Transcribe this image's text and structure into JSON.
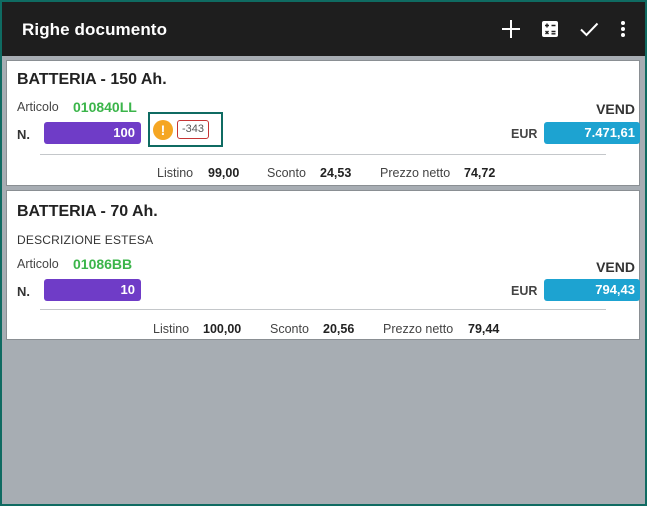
{
  "appbar": {
    "title": "Righe documento",
    "icons": [
      "add-icon",
      "calculator-icon",
      "check-icon",
      "more-vert-icon"
    ]
  },
  "labels": {
    "article": "Articolo",
    "qty": "N.",
    "currency": "EUR",
    "list_price": "Listino",
    "discount": "Sconto",
    "net_price": "Prezzo netto"
  },
  "rows": [
    {
      "name": "BATTERIA - 150 Ah.",
      "description": "",
      "code": "010840LL",
      "type": "VEND",
      "qty": "100",
      "warning": "-343",
      "price": "7.471,61",
      "list_price": "99,00",
      "discount": "24,53",
      "net_price": "74,72"
    },
    {
      "name": "BATTERIA - 70 Ah.",
      "description": "DESCRIZIONE ESTESA",
      "code": "01086BB",
      "type": "VEND",
      "qty": "10",
      "price": "794,43",
      "list_price": "100,00",
      "discount": "20,56",
      "net_price": "79,44"
    }
  ],
  "colors": {
    "appbar": "#1e1e1e",
    "background": "#a7adb3",
    "code": "#3bb54a",
    "qty_field": "#6f3cc7",
    "price_field": "#1da3d1",
    "warning": "#f5a623",
    "highlight_border": "#0f6b62"
  }
}
